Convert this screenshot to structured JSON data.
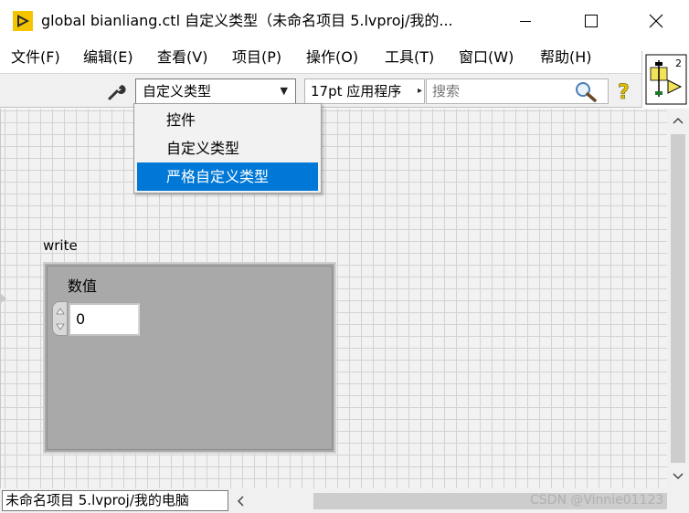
{
  "window": {
    "title": "global bianliang.ctl 自定义类型（未命名项目 5.lvproj/我的..."
  },
  "menu": {
    "items": [
      {
        "label": "文件(F)"
      },
      {
        "label": "编辑(E)"
      },
      {
        "label": "查看(V)"
      },
      {
        "label": "项目(P)"
      },
      {
        "label": "操作(O)"
      },
      {
        "label": "工具(T)"
      },
      {
        "label": "窗口(W)"
      },
      {
        "label": "帮助(H)"
      }
    ]
  },
  "toolbar": {
    "typedef_value": "自定义类型",
    "font_value": "17pt 应用程序",
    "search_placeholder": "搜索"
  },
  "vi_icon": {
    "terminal_number": "2"
  },
  "dropdown": {
    "items": [
      {
        "label": "控件",
        "selected": false
      },
      {
        "label": "自定义类型",
        "selected": false
      },
      {
        "label": "严格自定义类型",
        "selected": true
      }
    ]
  },
  "cluster": {
    "label": "write",
    "numeric": {
      "label": "数值",
      "value": "0"
    }
  },
  "statusbar": {
    "path": "未命名项目 5.lvproj/我的电脑",
    "watermark": "CSDN @Vinnie01123"
  },
  "colors": {
    "accent": "#0078d7",
    "cluster_fill": "#a9a9a9",
    "grid_line": "#d3d3d3"
  }
}
